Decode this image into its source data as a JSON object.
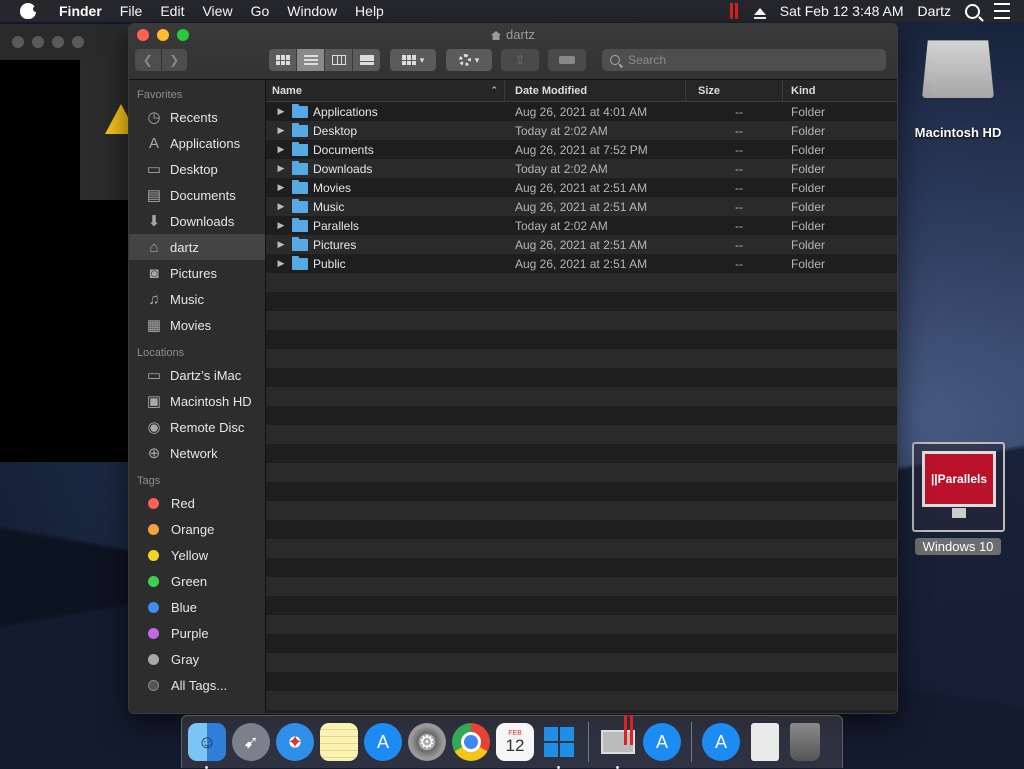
{
  "menubar": {
    "app_name": "Finder",
    "items": [
      "File",
      "Edit",
      "View",
      "Go",
      "Window",
      "Help"
    ],
    "clock": "Sat Feb 12  3:48 AM",
    "user": "Dartz"
  },
  "window": {
    "title": "dartz",
    "search_placeholder": "Search"
  },
  "sidebar": {
    "favorites_heading": "Favorites",
    "favorites": [
      {
        "label": "Recents",
        "icon": "clock-icon"
      },
      {
        "label": "Applications",
        "icon": "applications-icon"
      },
      {
        "label": "Desktop",
        "icon": "desktop-icon"
      },
      {
        "label": "Documents",
        "icon": "document-icon"
      },
      {
        "label": "Downloads",
        "icon": "download-icon"
      },
      {
        "label": "dartz",
        "icon": "home-icon"
      },
      {
        "label": "Pictures",
        "icon": "camera-icon"
      },
      {
        "label": "Music",
        "icon": "music-icon"
      },
      {
        "label": "Movies",
        "icon": "film-icon"
      }
    ],
    "locations_heading": "Locations",
    "locations": [
      {
        "label": "Dartz’s iMac",
        "icon": "computer-icon"
      },
      {
        "label": "Macintosh HD",
        "icon": "disk-icon"
      },
      {
        "label": "Remote Disc",
        "icon": "disc-icon"
      },
      {
        "label": "Network",
        "icon": "globe-icon"
      }
    ],
    "tags_heading": "Tags",
    "tags": [
      {
        "label": "Red",
        "color": "#fe5f57"
      },
      {
        "label": "Orange",
        "color": "#f6a23a"
      },
      {
        "label": "Yellow",
        "color": "#f5d323"
      },
      {
        "label": "Green",
        "color": "#3fcf4f"
      },
      {
        "label": "Blue",
        "color": "#3d8ef0"
      },
      {
        "label": "Purple",
        "color": "#bd6be0"
      },
      {
        "label": "Gray",
        "color": "#a8a8a8"
      },
      {
        "label": "All Tags...",
        "color": "#555555"
      }
    ]
  },
  "columns": {
    "name": "Name",
    "date": "Date Modified",
    "size": "Size",
    "kind": "Kind"
  },
  "files": [
    {
      "name": "Applications",
      "date": "Aug 26, 2021 at 4:01 AM",
      "size": "--",
      "kind": "Folder"
    },
    {
      "name": "Desktop",
      "date": "Today at 2:02 AM",
      "size": "--",
      "kind": "Folder"
    },
    {
      "name": "Documents",
      "date": "Aug 26, 2021 at 7:52 PM",
      "size": "--",
      "kind": "Folder"
    },
    {
      "name": "Downloads",
      "date": "Today at 2:02 AM",
      "size": "--",
      "kind": "Folder"
    },
    {
      "name": "Movies",
      "date": "Aug 26, 2021 at 2:51 AM",
      "size": "--",
      "kind": "Folder"
    },
    {
      "name": "Music",
      "date": "Aug 26, 2021 at 2:51 AM",
      "size": "--",
      "kind": "Folder"
    },
    {
      "name": "Parallels",
      "date": "Today at 2:02 AM",
      "size": "--",
      "kind": "Folder"
    },
    {
      "name": "Pictures",
      "date": "Aug 26, 2021 at 2:51 AM",
      "size": "--",
      "kind": "Folder"
    },
    {
      "name": "Public",
      "date": "Aug 26, 2021 at 2:51 AM",
      "size": "--",
      "kind": "Folder"
    }
  ],
  "desktop": {
    "hd_label": "Macintosh HD",
    "vm_label": "Windows 10",
    "vm_brand": "||Parallels"
  },
  "dock": {
    "apps": [
      {
        "name": "finder-icon",
        "color": "#3b8fe0",
        "glyph": "☺",
        "running": true
      },
      {
        "name": "launchpad-icon",
        "color": "#6f7680",
        "glyph": "🚀",
        "running": false
      },
      {
        "name": "safari-icon",
        "color": "#2f8fe8",
        "glyph": "⊕",
        "running": false
      },
      {
        "name": "notes-icon",
        "color": "#f4e38a",
        "glyph": "",
        "running": false
      },
      {
        "name": "app-store-icon",
        "color": "#1d8cf2",
        "glyph": "A",
        "running": false
      },
      {
        "name": "system-preferences-icon",
        "color": "#8d8d8d",
        "glyph": "⚙",
        "running": false
      },
      {
        "name": "chrome-icon",
        "color": "#e64335",
        "glyph": "◉",
        "running": false
      },
      {
        "name": "calendar-icon",
        "color": "#f2f2f2",
        "glyph": "12",
        "running": false
      },
      {
        "name": "windows-icon",
        "color": "#1e6fd9",
        "glyph": "⊞",
        "running": true
      },
      {
        "name": "parallels-desktop-icon",
        "color": "#c9c9c9",
        "glyph": "▭",
        "running": true
      },
      {
        "name": "app-store-alt-icon",
        "color": "#1d8cf2",
        "glyph": "A",
        "running": false
      },
      {
        "name": "downloads-stack-icon",
        "color": "#1d8cf2",
        "glyph": "A",
        "running": false
      },
      {
        "name": "document-stack-icon",
        "color": "#e6e6e6",
        "glyph": "",
        "running": false
      },
      {
        "name": "trash-icon",
        "color": "#6d6d6d",
        "glyph": "🗑",
        "running": false
      }
    ],
    "calendar_month": "FEB",
    "calendar_day": "12"
  }
}
